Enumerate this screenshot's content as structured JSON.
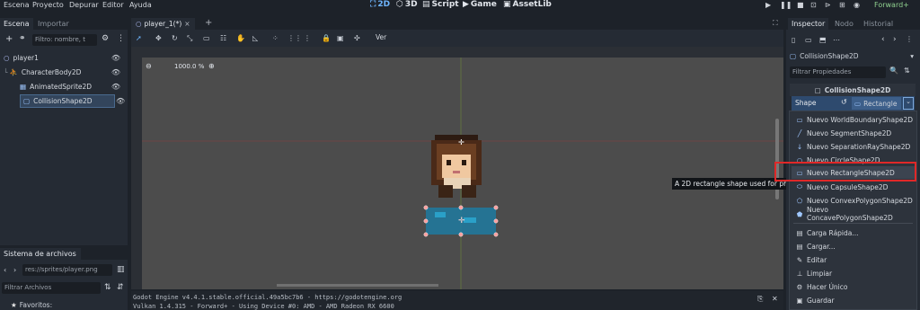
{
  "menubar": {
    "items": [
      "Escena",
      "Proyecto",
      "Depurar",
      "Editor",
      "Ayuda"
    ],
    "workspaces": [
      {
        "icon": "2d-icon",
        "label": "2D",
        "active": true
      },
      {
        "icon": "3d-icon",
        "label": "3D",
        "active": false
      },
      {
        "icon": "script-icon",
        "label": "Script",
        "active": false
      },
      {
        "icon": "game-icon",
        "label": "Game",
        "active": false
      },
      {
        "icon": "assetlib-icon",
        "label": "AssetLib",
        "active": false
      }
    ],
    "renderer": "Forward+"
  },
  "scene_dock": {
    "tabs": [
      "Escena",
      "Importar"
    ],
    "filter_placeholder": "Filtro: nombre, t",
    "tree": [
      {
        "label": "player1",
        "icon": "node2d-icon"
      },
      {
        "label": "CharacterBody2D",
        "icon": "characterbody-icon"
      },
      {
        "label": "AnimatedSprite2D",
        "icon": "animatedsprite-icon"
      },
      {
        "label": "CollisionShape2D",
        "icon": "collisionshape-icon",
        "selected": true
      }
    ]
  },
  "filesystem_dock": {
    "title": "Sistema de archivos",
    "path": "res://sprites/player.png",
    "filter_placeholder": "Filtrar Archivos",
    "favorites_label": "Favoritos:"
  },
  "editor": {
    "tab_label": "player_1(*)",
    "view_label": "Ver",
    "zoom": "1000.0 %"
  },
  "output": {
    "line1": "Godot Engine v4.4.1.stable.official.49a5bc7b6 - https://godotengine.org",
    "line2": "Vulkan 1.4.315 - Forward+ - Using Device #0: AMD - AMD Radeon RX 6600"
  },
  "tooltip": "A 2D rectangle shape used for physics collision.",
  "inspector": {
    "tabs": [
      "Inspector",
      "Nodo",
      "Historial"
    ],
    "node_name": "CollisionShape2D",
    "filter_placeholder": "Filtrar Propiedades",
    "section_title": "CollisionShape2D",
    "property_label": "Shape",
    "property_value": "Rectangle",
    "menu_new": [
      {
        "label": "Nuevo WorldBoundaryShape2D",
        "icon": "worldboundary-icon"
      },
      {
        "label": "Nuevo SegmentShape2D",
        "icon": "segment-icon"
      },
      {
        "label": "Nuevo SeparationRayShape2D",
        "icon": "separationray-icon"
      },
      {
        "label": "Nuevo CircleShape2D",
        "icon": "circle-icon"
      },
      {
        "label": "Nuevo RectangleShape2D",
        "icon": "rectangle-icon",
        "highlighted": true
      },
      {
        "label": "Nuevo CapsuleShape2D",
        "icon": "capsule-icon"
      },
      {
        "label": "Nuevo ConvexPolygonShape2D",
        "icon": "convexpolygon-icon"
      },
      {
        "label": "Nuevo ConcavePolygonShape2D",
        "icon": "concavepolygon-icon"
      }
    ],
    "menu_actions": [
      {
        "label": "Carga Rápida...",
        "icon": "quickload-icon"
      },
      {
        "label": "Cargar...",
        "icon": "load-icon"
      },
      {
        "label": "Editar",
        "icon": "edit-icon"
      },
      {
        "label": "Limpiar",
        "icon": "clear-icon"
      },
      {
        "label": "Hacer Único",
        "icon": "make-unique-icon"
      },
      {
        "label": "Guardar",
        "icon": "save-icon"
      }
    ]
  },
  "colors": {
    "accent": "#6fb6ff",
    "highlight_box": "#e02828",
    "panel": "#252b34",
    "viewport": "#4c4c4c",
    "selection_handle": "#ff8f8f"
  }
}
